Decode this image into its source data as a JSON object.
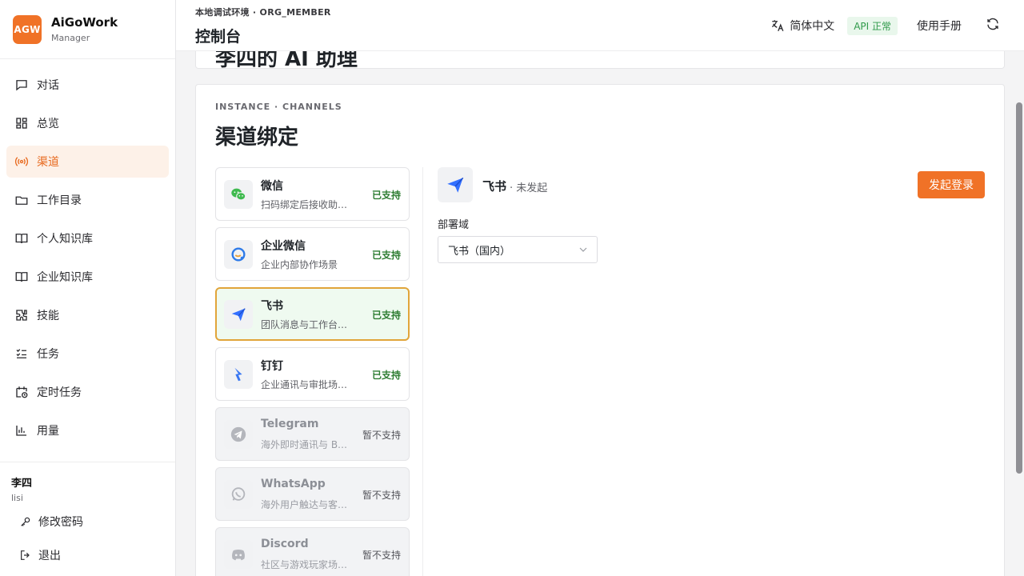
{
  "brand": {
    "logo": "AGW",
    "name": "AiGoWork",
    "role": "Manager"
  },
  "nav": [
    {
      "label": "对话",
      "icon": "chat-icon",
      "active": false
    },
    {
      "label": "总览",
      "icon": "dashboard-icon",
      "active": false
    },
    {
      "label": "渠道",
      "icon": "broadcast-icon",
      "active": true
    },
    {
      "label": "工作目录",
      "icon": "folder-icon",
      "active": false
    },
    {
      "label": "个人知识库",
      "icon": "book-icon",
      "active": false
    },
    {
      "label": "企业知识库",
      "icon": "book-icon",
      "active": false
    },
    {
      "label": "技能",
      "icon": "puzzle-icon",
      "active": false
    },
    {
      "label": "任务",
      "icon": "checklist-icon",
      "active": false
    },
    {
      "label": "定时任务",
      "icon": "calendar-clock-icon",
      "active": false
    },
    {
      "label": "用量",
      "icon": "bar-chart-icon",
      "active": false
    }
  ],
  "user": {
    "name": "李四",
    "id": "lisi",
    "change_password": "修改密码",
    "logout": "退出"
  },
  "header": {
    "env": "本地调试环境 · ORG_MEMBER",
    "title": "控制台",
    "language": "简体中文",
    "api_status": "API 正常",
    "manual": "使用手册"
  },
  "top_card": {
    "title": "李四的 AI 助理"
  },
  "channels": {
    "eyebrow": "INSTANCE · CHANNELS",
    "title": "渠道绑定",
    "items": [
      {
        "name": "微信",
        "desc": "扫码绑定后接收助…",
        "status": "已支持",
        "icon": "wechat-icon",
        "color": "#3fba4f"
      },
      {
        "name": "企业微信",
        "desc": "企业内部协作场景",
        "status": "已支持",
        "icon": "wecom-icon",
        "color": "#2f7be8"
      },
      {
        "name": "飞书",
        "desc": "团队消息与工作台…",
        "status": "已支持",
        "icon": "feishu-icon",
        "color": "#3370ff"
      },
      {
        "name": "钉钉",
        "desc": "企业通讯与审批场…",
        "status": "已支持",
        "icon": "dingtalk-icon",
        "color": "#3a78f2"
      },
      {
        "name": "Telegram",
        "desc": "海外即时通讯与 B…",
        "status": "暂不支持",
        "icon": "telegram-icon",
        "color": "#b4b6bc"
      },
      {
        "name": "WhatsApp",
        "desc": "海外用户触达与客…",
        "status": "暂不支持",
        "icon": "whatsapp-icon",
        "color": "#b4b6bc"
      },
      {
        "name": "Discord",
        "desc": "社区与游戏玩家场…",
        "status": "暂不支持",
        "icon": "discord-icon",
        "color": "#b4b6bc"
      }
    ]
  },
  "detail": {
    "name": "飞书",
    "status": "· 未发起",
    "login_button": "发起登录",
    "field_label": "部署域",
    "field_value": "飞书（国内）"
  },
  "colors": {
    "accent": "#f07227",
    "selected_border": "#e1a53a",
    "supported": "#2e7d32"
  }
}
